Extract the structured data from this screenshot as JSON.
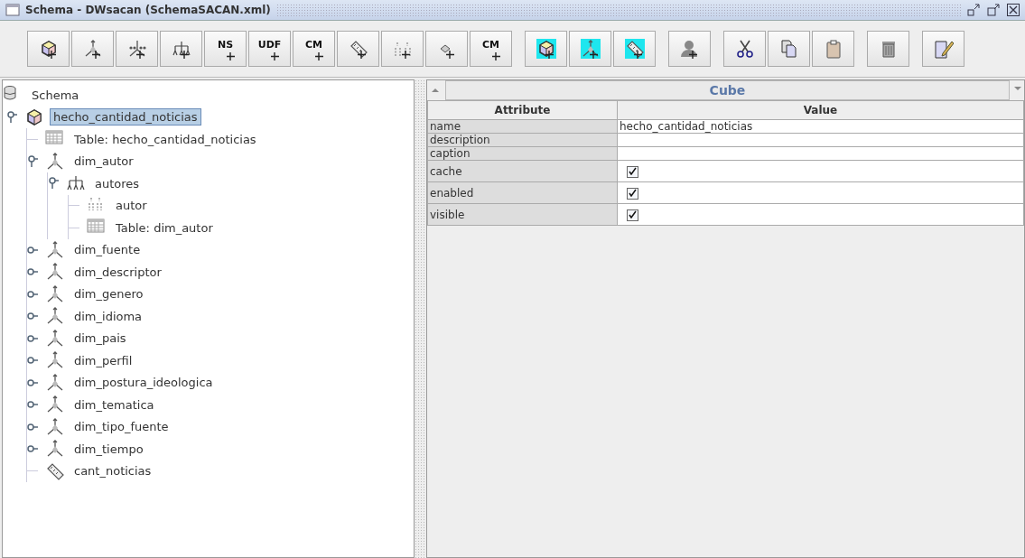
{
  "window": {
    "title": "Schema - DWsacan (SchemaSACAN.xml)"
  },
  "toolbar": {
    "groups": [
      [
        {
          "kind": "cube"
        },
        {
          "kind": "axes"
        },
        {
          "kind": "axes-dots"
        },
        {
          "kind": "hierarchy"
        },
        {
          "kind": "text",
          "label": "NS"
        },
        {
          "kind": "text",
          "label": "UDF"
        },
        {
          "kind": "text",
          "label": "CM"
        },
        {
          "kind": "measure"
        },
        {
          "kind": "levels"
        },
        {
          "kind": "diamond"
        },
        {
          "kind": "text-diamond",
          "label": "CM"
        }
      ],
      [
        {
          "kind": "cube",
          "highlighted": true
        },
        {
          "kind": "axes",
          "highlighted": true
        },
        {
          "kind": "measure",
          "highlighted": true
        }
      ],
      [
        {
          "kind": "person"
        }
      ],
      [
        {
          "kind": "cut"
        },
        {
          "kind": "copy"
        },
        {
          "kind": "paste"
        }
      ],
      [
        {
          "kind": "delete"
        }
      ],
      [
        {
          "kind": "edit"
        }
      ]
    ]
  },
  "tree": {
    "label": "Schema",
    "kind": "schema",
    "children": [
      {
        "label": "hecho_cantidad_noticias",
        "kind": "cube",
        "selected": true,
        "expanded": true,
        "children": [
          {
            "label": "Table: hecho_cantidad_noticias",
            "kind": "table",
            "selected": false
          },
          {
            "label": "dim_autor",
            "kind": "dimension",
            "selected": false,
            "expanded": true,
            "children": [
              {
                "label": "autores",
                "kind": "hierarchy",
                "selected": false,
                "expanded": true,
                "children": [
                  {
                    "label": "autor",
                    "kind": "level",
                    "selected": false
                  },
                  {
                    "label": "Table: dim_autor",
                    "kind": "table",
                    "selected": false
                  }
                ]
              }
            ]
          },
          {
            "label": "dim_fuente",
            "kind": "dimension",
            "selected": false,
            "expanded": false
          },
          {
            "label": "dim_descriptor",
            "kind": "dimension",
            "selected": false,
            "expanded": false
          },
          {
            "label": "dim_genero",
            "kind": "dimension",
            "selected": false,
            "expanded": false
          },
          {
            "label": "dim_idioma",
            "kind": "dimension",
            "selected": false,
            "expanded": false
          },
          {
            "label": "dim_pais",
            "kind": "dimension",
            "selected": false,
            "expanded": false
          },
          {
            "label": "dim_perfil",
            "kind": "dimension",
            "selected": false,
            "expanded": false
          },
          {
            "label": "dim_postura_ideologica",
            "kind": "dimension",
            "selected": false,
            "expanded": false
          },
          {
            "label": "dim_tematica",
            "kind": "dimension",
            "selected": false,
            "expanded": false
          },
          {
            "label": "dim_tipo_fuente",
            "kind": "dimension",
            "selected": false,
            "expanded": false
          },
          {
            "label": "dim_tiempo",
            "kind": "dimension",
            "selected": false,
            "expanded": false
          },
          {
            "label": "cant_noticias",
            "kind": "measure",
            "selected": false
          }
        ]
      }
    ]
  },
  "properties": {
    "title": "Cube",
    "columns": [
      "Attribute",
      "Value"
    ],
    "rows": [
      {
        "attribute": "name",
        "kind": "text",
        "value": "hecho_cantidad_noticias"
      },
      {
        "attribute": "description",
        "kind": "text"
      },
      {
        "attribute": "caption",
        "kind": "text"
      },
      {
        "attribute": "cache",
        "kind": "checkbox",
        "checked": true
      },
      {
        "attribute": "enabled",
        "kind": "checkbox",
        "checked": true
      },
      {
        "attribute": "visible",
        "kind": "checkbox",
        "checked": true
      }
    ]
  }
}
